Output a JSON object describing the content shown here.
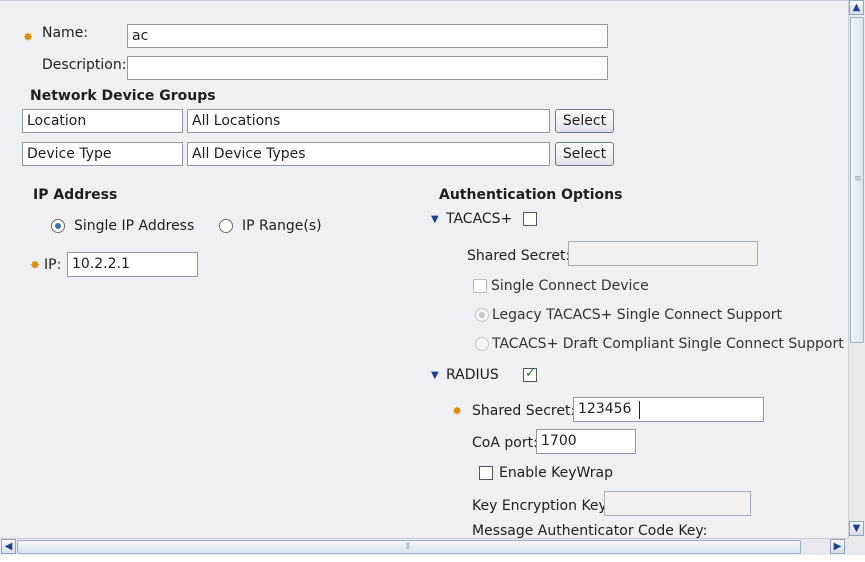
{
  "form": {
    "name_label": "Name:",
    "name_value": "ac",
    "description_label": "Description:",
    "description_value": "",
    "required_icon": "gear-star-icon"
  },
  "ndg": {
    "title": "Network Device Groups",
    "select_label": "Select",
    "rows": [
      {
        "name": "Location",
        "value": "All Locations"
      },
      {
        "name": "Device Type",
        "value": "All Device Types"
      }
    ]
  },
  "ip": {
    "title": "IP Address",
    "single_label": "Single IP Address",
    "range_label": "IP Range(s)",
    "selected": "single",
    "ip_label": "IP:",
    "ip_value": "10.2.2.1"
  },
  "auth": {
    "title": "Authentication Options",
    "tacacs": {
      "label": "TACACS+",
      "checked": false,
      "shared_secret_label": "Shared Secret:",
      "single_connect_label": "Single Connect Device",
      "legacy_label": "Legacy TACACS+ Single Connect Support",
      "draft_label": "TACACS+ Draft Compliant Single Connect Support"
    },
    "radius": {
      "label": "RADIUS",
      "checked": true,
      "shared_secret_label": "Shared Secret:",
      "shared_secret_value": "123456",
      "coa_label": "CoA port:",
      "coa_value": "1700",
      "keywrap_label": "Enable KeyWrap",
      "kek_label": "Key Encryption Key:",
      "mack_label": "Message Authenticator Code Key:"
    }
  },
  "scroll": {
    "up_icon": "chevron-up-icon",
    "down_icon": "chevron-down-icon",
    "left_icon": "chevron-left-icon",
    "right_icon": "chevron-right-icon"
  },
  "colors": {
    "panel_bg": "#eef0f4",
    "required": "#e08a00",
    "accent": "#1c3f94"
  }
}
